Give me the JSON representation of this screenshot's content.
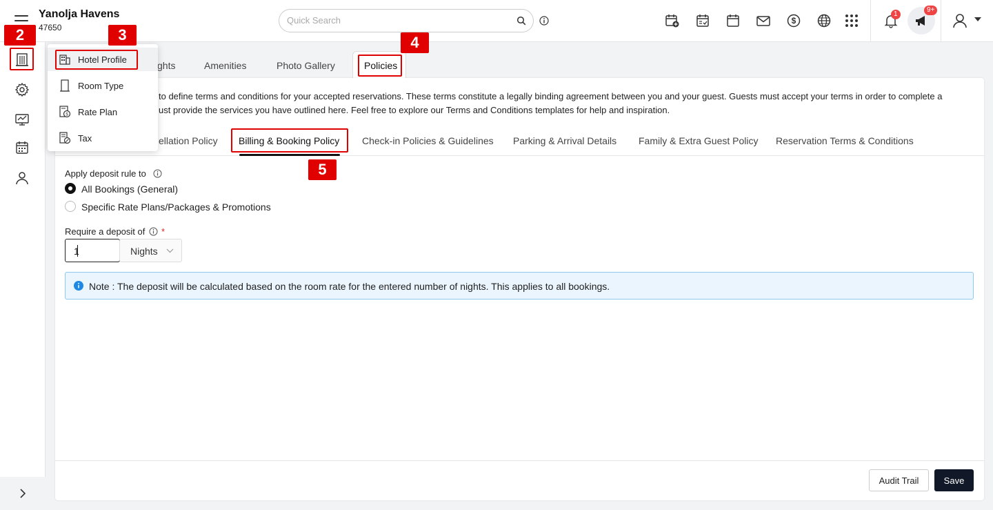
{
  "header": {
    "hotel_name": "Yanolja Havens",
    "hotel_id": "47650",
    "search_placeholder": "Quick Search",
    "notifications_count": "1",
    "announcements_count": "9+"
  },
  "annotations": [
    "2",
    "3",
    "4",
    "5"
  ],
  "flyout_menu": {
    "items": [
      {
        "label": "Hotel Profile",
        "icon": "building-icon"
      },
      {
        "label": "Room Type",
        "icon": "door-icon"
      },
      {
        "label": "Rate Plan",
        "icon": "rate-plan-icon"
      },
      {
        "label": "Tax",
        "icon": "tax-receipt-icon"
      }
    ]
  },
  "profile_tabs": [
    "ghts",
    "Amenities",
    "Photo Gallery",
    "Policies"
  ],
  "description": {
    "line1": "to define terms and conditions for your accepted reservations. These terms constitute a legally binding agreement between you and your guest. Guests must accept your terms in order to complete a",
    "line2": "ust provide the services you have outlined here. Feel free to explore our Terms and Conditions templates for help and inspiration."
  },
  "policy_tabs": [
    "ellation Policy",
    "Billing & Booking Policy",
    "Check-in Policies & Guidelines",
    "Parking & Arrival Details",
    "Family & Extra Guest Policy",
    "Reservation Terms & Conditions"
  ],
  "form": {
    "deposit_rule_label": "Apply deposit rule to",
    "options": [
      "All Bookings (General)",
      "Specific Rate Plans/Packages & Promotions"
    ],
    "selected_option": "All Bookings (General)",
    "deposit_label": "Require a deposit of",
    "required_mark": "*",
    "deposit_value": "1",
    "deposit_unit": "Nights"
  },
  "note": "Note : The deposit will be calculated based on the room rate for the entered number of nights. This applies to all bookings.",
  "footer": {
    "audit_label": "Audit Trail",
    "save_label": "Save"
  },
  "colors": {
    "accent_dark": "#111827",
    "annotation_red": "#e00000",
    "note_bg": "#eaf5fd",
    "badge_red": "#ef4444"
  }
}
